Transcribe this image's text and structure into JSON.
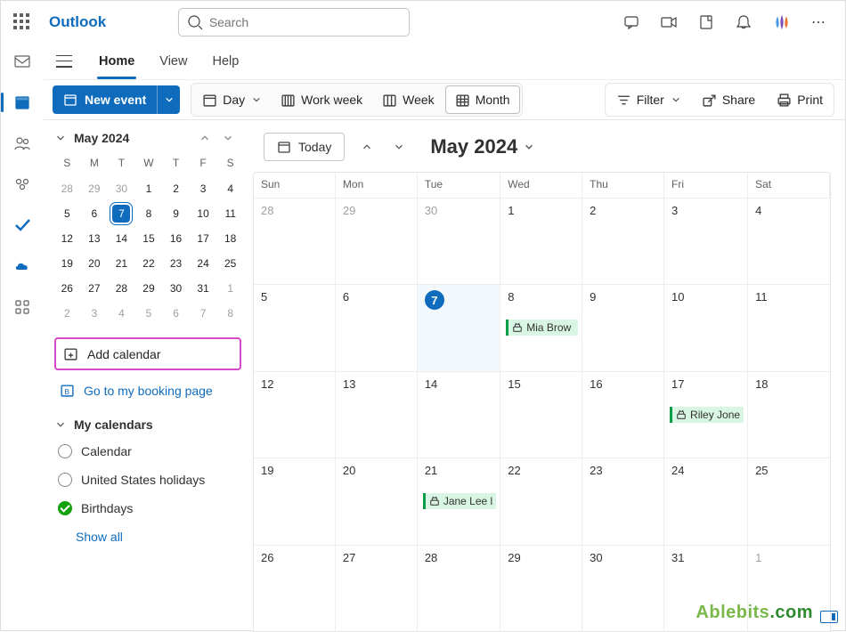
{
  "brand": "Outlook",
  "search": {
    "placeholder": "Search"
  },
  "tabs": {
    "home": "Home",
    "view": "View",
    "help": "Help"
  },
  "toolbar": {
    "new_event": "New event",
    "day": "Day",
    "workweek": "Work week",
    "week": "Week",
    "month": "Month",
    "filter": "Filter",
    "share": "Share",
    "print": "Print"
  },
  "minical": {
    "label": "May 2024",
    "dow": [
      "S",
      "M",
      "T",
      "W",
      "T",
      "F",
      "S"
    ],
    "rows": [
      [
        {
          "n": "28",
          "dim": true
        },
        {
          "n": "29",
          "dim": true
        },
        {
          "n": "30",
          "dim": true
        },
        {
          "n": "1"
        },
        {
          "n": "2"
        },
        {
          "n": "3"
        },
        {
          "n": "4"
        }
      ],
      [
        {
          "n": "5"
        },
        {
          "n": "6"
        },
        {
          "n": "7",
          "today": true
        },
        {
          "n": "8"
        },
        {
          "n": "9"
        },
        {
          "n": "10"
        },
        {
          "n": "11"
        }
      ],
      [
        {
          "n": "12"
        },
        {
          "n": "13"
        },
        {
          "n": "14"
        },
        {
          "n": "15"
        },
        {
          "n": "16"
        },
        {
          "n": "17"
        },
        {
          "n": "18"
        }
      ],
      [
        {
          "n": "19"
        },
        {
          "n": "20"
        },
        {
          "n": "21"
        },
        {
          "n": "22"
        },
        {
          "n": "23"
        },
        {
          "n": "24"
        },
        {
          "n": "25"
        }
      ],
      [
        {
          "n": "26"
        },
        {
          "n": "27"
        },
        {
          "n": "28"
        },
        {
          "n": "29"
        },
        {
          "n": "30"
        },
        {
          "n": "31"
        },
        {
          "n": "1",
          "dim": true
        }
      ],
      [
        {
          "n": "2",
          "dim": true
        },
        {
          "n": "3",
          "dim": true
        },
        {
          "n": "4",
          "dim": true
        },
        {
          "n": "5",
          "dim": true
        },
        {
          "n": "6",
          "dim": true
        },
        {
          "n": "7",
          "dim": true
        },
        {
          "n": "8",
          "dim": true
        }
      ]
    ]
  },
  "sidebar": {
    "add_calendar": "Add calendar",
    "booking": "Go to my booking page",
    "section": "My calendars",
    "cals": [
      {
        "label": "Calendar",
        "checked": false
      },
      {
        "label": "United States holidays",
        "checked": false
      },
      {
        "label": "Birthdays",
        "checked": true
      }
    ],
    "show_all": "Show all"
  },
  "calendar": {
    "today": "Today",
    "title": "May 2024",
    "dow": [
      "Sun",
      "Mon",
      "Tue",
      "Wed",
      "Thu",
      "Fri",
      "Sat"
    ],
    "weeks": [
      [
        {
          "n": "28",
          "dim": true
        },
        {
          "n": "29",
          "dim": true
        },
        {
          "n": "30",
          "dim": true
        },
        {
          "n": "1"
        },
        {
          "n": "2"
        },
        {
          "n": "3"
        },
        {
          "n": "4"
        }
      ],
      [
        {
          "n": "5"
        },
        {
          "n": "6"
        },
        {
          "n": "7",
          "today": true
        },
        {
          "n": "8",
          "ev": "Mia Brow"
        },
        {
          "n": "9"
        },
        {
          "n": "10"
        },
        {
          "n": "11"
        }
      ],
      [
        {
          "n": "12"
        },
        {
          "n": "13"
        },
        {
          "n": "14"
        },
        {
          "n": "15"
        },
        {
          "n": "16"
        },
        {
          "n": "17",
          "ev": "Riley Jone"
        },
        {
          "n": "18"
        }
      ],
      [
        {
          "n": "19"
        },
        {
          "n": "20"
        },
        {
          "n": "21",
          "ev": "Jane Lee l"
        },
        {
          "n": "22"
        },
        {
          "n": "23"
        },
        {
          "n": "24"
        },
        {
          "n": "25"
        }
      ],
      [
        {
          "n": "26"
        },
        {
          "n": "27"
        },
        {
          "n": "28"
        },
        {
          "n": "29"
        },
        {
          "n": "30"
        },
        {
          "n": "31"
        },
        {
          "n": "1",
          "dim": true
        }
      ]
    ]
  },
  "watermark": "Ablebits",
  "watermark_suffix": ".com"
}
